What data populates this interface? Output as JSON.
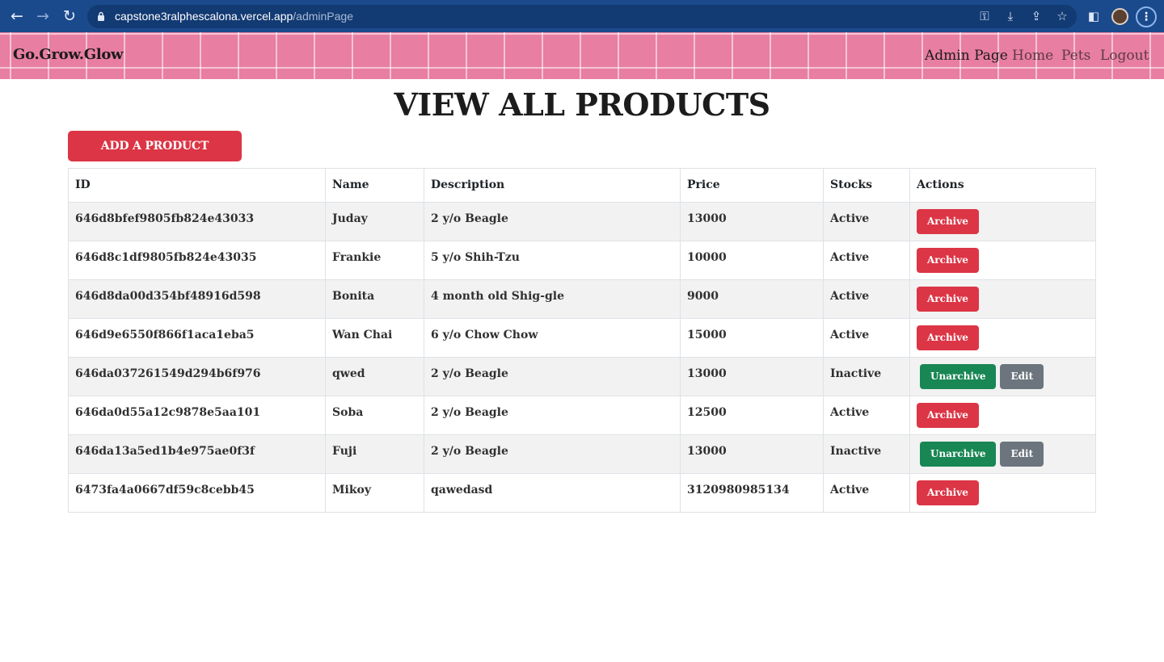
{
  "browser": {
    "url_host": "capstone3ralphescalona.vercel.app",
    "url_path": "/adminPage"
  },
  "navbar": {
    "brand": "Go.Grow.Glow",
    "links": [
      "Admin Page",
      "Home",
      "Pets",
      "Logout"
    ]
  },
  "page": {
    "title": "VIEW ALL PRODUCTS",
    "add_button": "ADD A PRODUCT"
  },
  "table": {
    "headers": [
      "ID",
      "Name",
      "Description",
      "Price",
      "Stocks",
      "Actions"
    ],
    "rows": [
      {
        "id": "646d8bfef9805fb824e43033",
        "name": "Juday",
        "description": "2 y/o Beagle",
        "price": "13000",
        "stocks": "Active",
        "actions": [
          "Archive"
        ]
      },
      {
        "id": "646d8c1df9805fb824e43035",
        "name": "Frankie",
        "description": "5 y/o Shih-Tzu",
        "price": "10000",
        "stocks": "Active",
        "actions": [
          "Archive"
        ]
      },
      {
        "id": "646d8da00d354bf48916d598",
        "name": "Bonita",
        "description": "4 month old Shig-gle",
        "price": "9000",
        "stocks": "Active",
        "actions": [
          "Archive"
        ]
      },
      {
        "id": "646d9e6550f866f1aca1eba5",
        "name": "Wan Chai",
        "description": "6 y/o Chow Chow",
        "price": "15000",
        "stocks": "Active",
        "actions": [
          "Archive"
        ]
      },
      {
        "id": "646da037261549d294b6f976",
        "name": "qwed",
        "description": "2 y/o Beagle",
        "price": "13000",
        "stocks": "Inactive",
        "actions": [
          "Unarchive",
          "Edit"
        ]
      },
      {
        "id": "646da0d55a12c9878e5aa101",
        "name": "Soba",
        "description": "2 y/o Beagle",
        "price": "12500",
        "stocks": "Active",
        "actions": [
          "Archive"
        ]
      },
      {
        "id": "646da13a5ed1b4e975ae0f3f",
        "name": "Fuji",
        "description": "2 y/o Beagle",
        "price": "13000",
        "stocks": "Inactive",
        "actions": [
          "Unarchive",
          "Edit"
        ]
      },
      {
        "id": "6473fa4a0667df59c8cebb45",
        "name": "Mikoy",
        "description": "qawedasd",
        "price": "3120980985134",
        "stocks": "Active",
        "actions": [
          "Archive"
        ]
      }
    ]
  },
  "colors": {
    "browser_bar": "#1a4a8c",
    "navbar_pink": "#e87ea1",
    "danger": "#dc3545",
    "success": "#198754",
    "secondary": "#6c757d"
  }
}
